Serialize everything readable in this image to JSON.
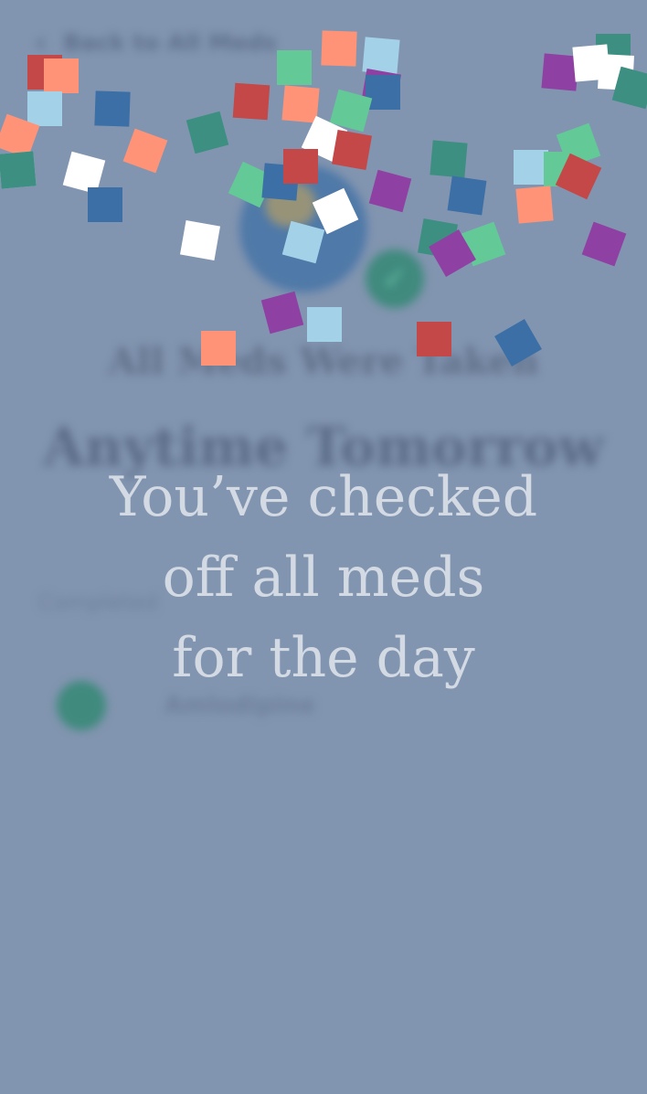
{
  "background_screen": {
    "back_link": "Back to All Meds",
    "heading": "All Meds Were Taken",
    "subheading": "Anytime Tomorrow",
    "section_label": "Completed",
    "med_name": "Amlodipine",
    "check_icon": "check-icon",
    "back_icon": "chevron-left-icon"
  },
  "celebration": {
    "message_lines": [
      "You’ve checked",
      "off all meds",
      "for the day"
    ]
  },
  "colors": {
    "background": "#8295b0",
    "message_text": "#d3dae4",
    "confetti": [
      "#c44848",
      "#ff9377",
      "#a3d2e8",
      "#3b6fa6",
      "#3d8f82",
      "#62c997",
      "#8f41a3",
      "#ffffff"
    ]
  }
}
